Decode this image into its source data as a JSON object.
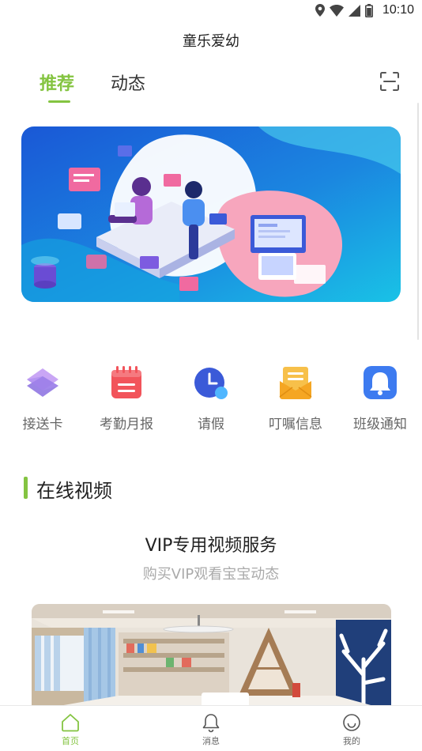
{
  "status_bar": {
    "time": "10:10",
    "icons": [
      "location-icon",
      "wifi-icon",
      "signal-icon",
      "battery-icon"
    ]
  },
  "app": {
    "title": "童乐爱幼",
    "accent_color": "#84c441"
  },
  "tabs": [
    {
      "label": "推荐",
      "active": true
    },
    {
      "label": "动态",
      "active": false
    }
  ],
  "header_actions": {
    "scan_icon": "scan-icon"
  },
  "quick_menu": [
    {
      "label": "接送卡",
      "icon": "layers-icon",
      "color": "#8a6fe0"
    },
    {
      "label": "考勤月报",
      "icon": "calendar-icon",
      "color": "#f2545b"
    },
    {
      "label": "请假",
      "icon": "clock-icon",
      "color": "#3b5ad8"
    },
    {
      "label": "叮嘱信息",
      "icon": "envelope-icon",
      "color": "#f5a623"
    },
    {
      "label": "班级通知",
      "icon": "bell-icon",
      "color": "#3d7bf0"
    }
  ],
  "section": {
    "title": "在线视频"
  },
  "vip": {
    "title": "VIP专用视频服务",
    "subtitle": "购买VIP观看宝宝动态"
  },
  "bottom_nav": [
    {
      "label": "首页",
      "icon": "home-icon",
      "active": true
    },
    {
      "label": "消息",
      "icon": "bell-icon",
      "active": false
    },
    {
      "label": "我的",
      "icon": "smile-icon",
      "active": false
    }
  ]
}
